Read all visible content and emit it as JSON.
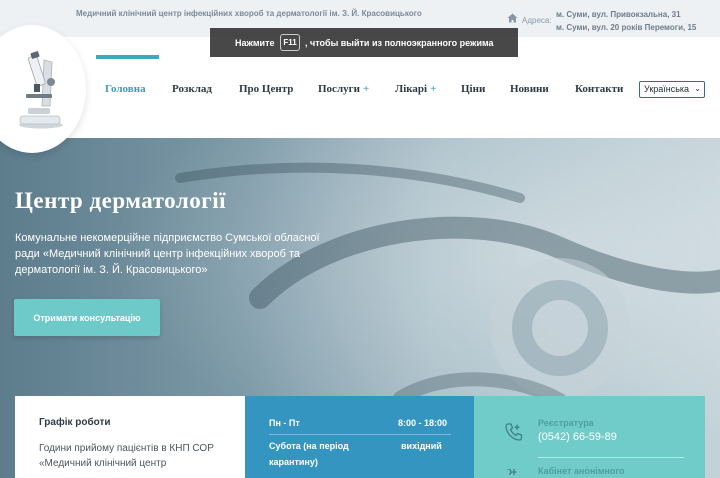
{
  "topbar": {
    "org_name": "Медичний клінічний центр інфекційних хвороб та дерматології ім. З. Й. Красовицького",
    "address_label": "Адреса:",
    "address_line1": "м. Суми, вул. Привокзальна, 31",
    "address_line2": "м. Суми, вул. 20 років Перемоги, 15",
    "address_icon": "home-icon"
  },
  "toast": {
    "before": "Нажмите",
    "key": "F11",
    "after": ", чтобы выйти из полноэкранного режима"
  },
  "nav": {
    "items": [
      {
        "label": "Головна"
      },
      {
        "label": "Розклад"
      },
      {
        "label": "Про Центр"
      },
      {
        "label": "Послуги",
        "plus": "+"
      },
      {
        "label": "Лікарі",
        "plus": "+"
      },
      {
        "label": "Ціни"
      },
      {
        "label": "Новини"
      },
      {
        "label": "Контакти"
      }
    ],
    "language": "Українська"
  },
  "hero": {
    "title": "Центр дерматології",
    "description": "Комунальне некомерційне підприємство Сумської обласної ради «Медичний клінічний центр інфекційних хвороб та дерматології ім. З. Й. Красовицького»",
    "cta_label": "Отримати консультацію"
  },
  "schedule_card": {
    "title": "Графік роботи",
    "text": "Години прийому пацієнтів в КНП СОР «Медичний клінічний центр"
  },
  "hours_card": {
    "row1_day": "Пн - Пт",
    "row1_time": "8:00 - 18:00",
    "row2_day_line1": "Субота (на період",
    "row2_day_line2": "карантину)",
    "row2_time": "вихідний"
  },
  "contact_card": {
    "registry_label": "Реєстратура",
    "registry_phone": "(0542) 66-59-89",
    "anon_label": "Кабінет анонімного"
  },
  "colors": {
    "accent": "#3da7c4",
    "blue_card": "#3496c0",
    "teal_card": "#6fccc9",
    "cta": "#6ecac8"
  }
}
